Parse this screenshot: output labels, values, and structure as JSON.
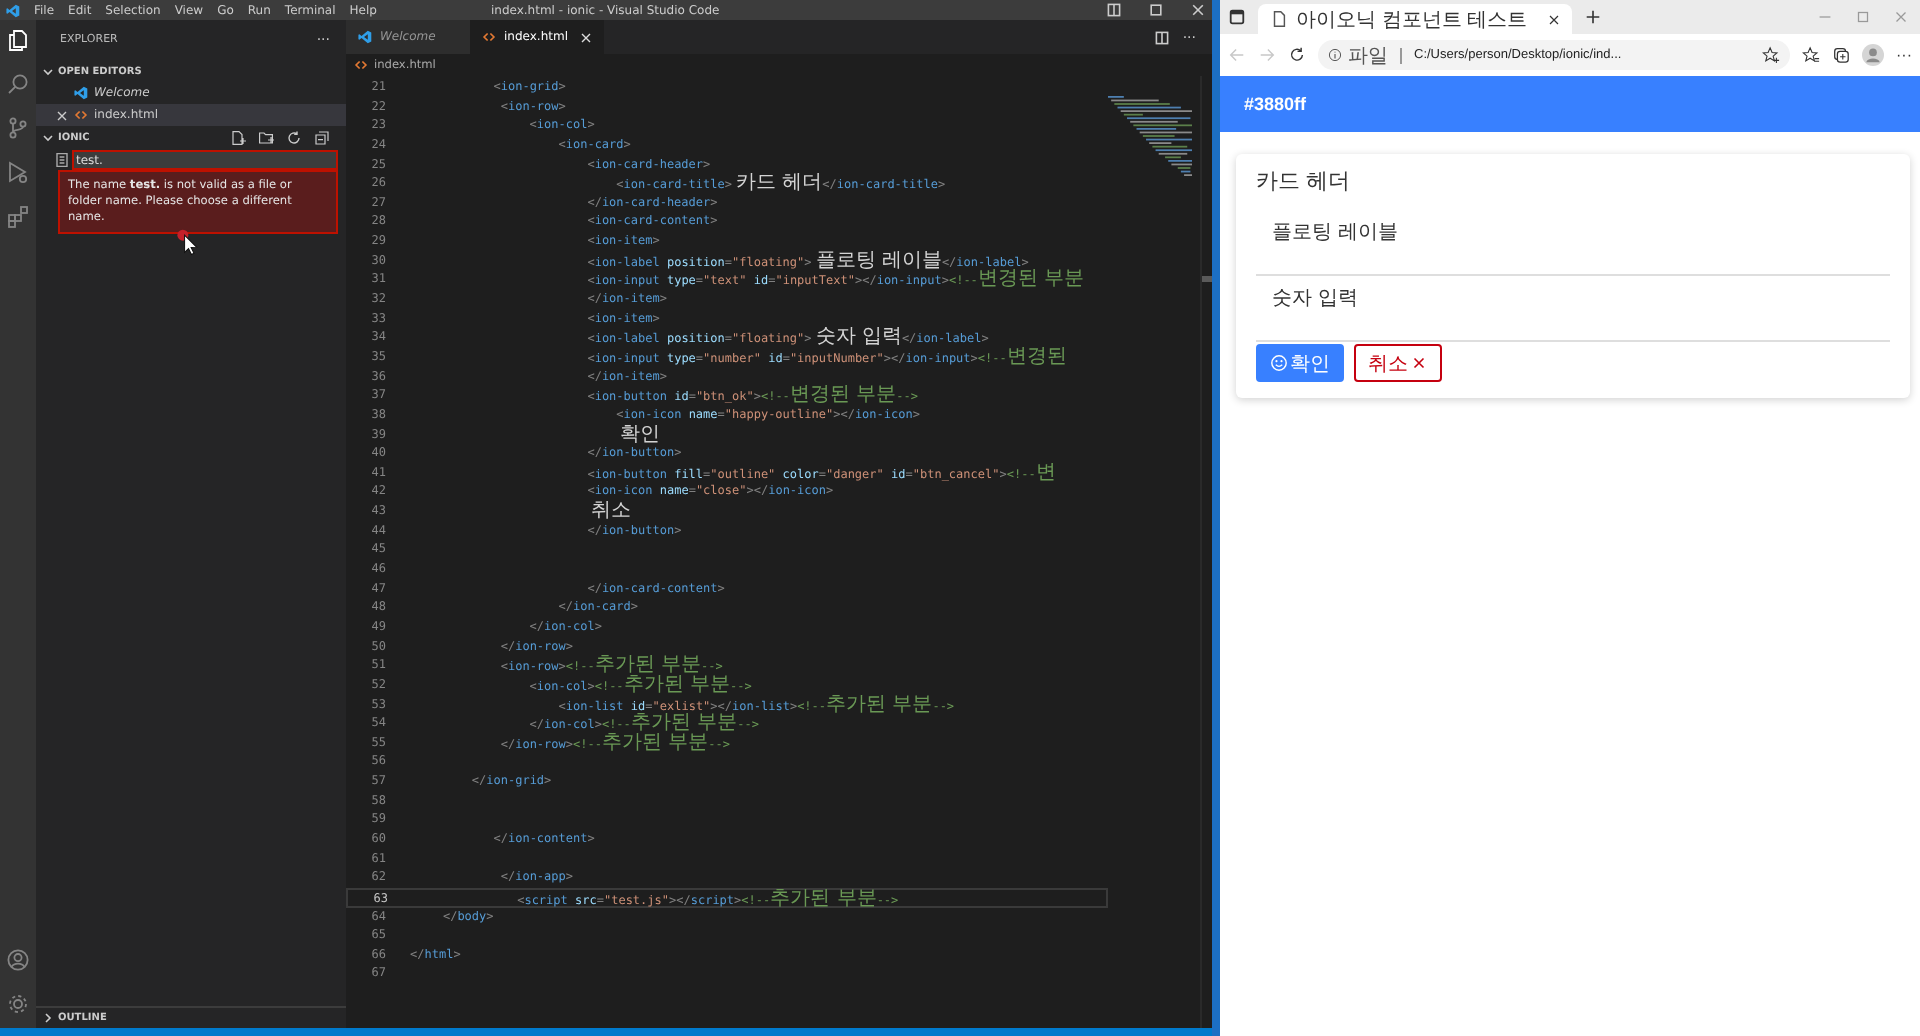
{
  "vscode": {
    "menu": [
      "File",
      "Edit",
      "Selection",
      "View",
      "Go",
      "Run",
      "Terminal",
      "Help"
    ],
    "title": "index.html - ionic - Visual Studio Code",
    "activity_bar": {
      "top": [
        {
          "kind": "files",
          "selected": true
        },
        {
          "kind": "search",
          "selected": false
        },
        {
          "kind": "source-control",
          "selected": false
        },
        {
          "kind": "run",
          "selected": false
        },
        {
          "kind": "extensions",
          "selected": false
        }
      ],
      "bottom": [
        {
          "kind": "account",
          "selected": false
        },
        {
          "kind": "settings",
          "selected": false
        }
      ]
    },
    "sidebar": {
      "title": "EXPLORER",
      "more": "···",
      "open_editors": {
        "title": "OPEN EDITORS",
        "expanded": true,
        "items": [
          {
            "kind": "vscode",
            "label": "Welcome",
            "preview": true,
            "selected": false
          },
          {
            "kind": "html",
            "label": "index.html",
            "preview": false,
            "selected": true
          }
        ]
      },
      "folder": {
        "title": "IONIC",
        "expanded": true,
        "rename_value": "test.",
        "error": "The name **test.** is not valid as a file or folder name. Please choose a different name."
      },
      "outline": {
        "title": "OUTLINE",
        "expanded": false
      }
    },
    "tabs": [
      {
        "kind": "vscode",
        "label": "Welcome",
        "preview": true,
        "selected": false
      },
      {
        "kind": "html",
        "label": "index.html",
        "preview": false,
        "selected": true
      }
    ],
    "editor_more": "···",
    "breadcrumb": "index.html",
    "lines": [
      {
        "number": "21",
        "text": "           <ion-grid>",
        "current": false
      },
      {
        "number": "22",
        "text": "            <ion-row>",
        "current": false
      },
      {
        "number": "23",
        "text": "                <ion-col>",
        "current": false
      },
      {
        "number": "24",
        "text": "                    <ion-card>",
        "current": false
      },
      {
        "number": "25",
        "text": "                        <ion-card-header>",
        "current": false
      },
      {
        "number": "26",
        "text": "                            <ion-card-title>카드 헤더</ion-card-title>",
        "current": false
      },
      {
        "number": "27",
        "text": "                        </ion-card-header>",
        "current": false
      },
      {
        "number": "28",
        "text": "                        <ion-card-content>",
        "current": false
      },
      {
        "number": "29",
        "text": "                        <ion-item>",
        "current": false
      },
      {
        "number": "30",
        "text": "                        <ion-label position=\"floating\">플로팅 레이블</ion-label>",
        "current": false
      },
      {
        "number": "31",
        "text": "                        <ion-input type=\"text\" id=\"inputText\"></ion-input><!--변경된 부분",
        "current": false
      },
      {
        "number": "32",
        "text": "                        </ion-item>",
        "current": false
      },
      {
        "number": "33",
        "text": "                        <ion-item>",
        "current": false
      },
      {
        "number": "34",
        "text": "                        <ion-label position=\"floating\">숫자 입력</ion-label>",
        "current": false
      },
      {
        "number": "35",
        "text": "                        <ion-input type=\"number\" id=\"inputNumber\"></ion-input><!--변경된",
        "current": false
      },
      {
        "number": "36",
        "text": "                        </ion-item>",
        "current": false
      },
      {
        "number": "37",
        "text": "                        <ion-button id=\"btn_ok\"><!--변경된 부분-->",
        "current": false
      },
      {
        "number": "38",
        "text": "                            <ion-icon name=\"happy-outline\"></ion-icon>",
        "current": false
      },
      {
        "number": "39",
        "text": "                            확인",
        "current": false
      },
      {
        "number": "40",
        "text": "                        </ion-button>",
        "current": false
      },
      {
        "number": "41",
        "text": "                        <ion-button fill=\"outline\" color=\"danger\" id=\"btn_cancel\"><!--변",
        "current": false
      },
      {
        "number": "42",
        "text": "                        <ion-icon name=\"close\"></ion-icon>",
        "current": false
      },
      {
        "number": "43",
        "text": "                        취소",
        "current": false
      },
      {
        "number": "44",
        "text": "                        </ion-button>",
        "current": false
      },
      {
        "number": "45",
        "current": false
      },
      {
        "number": "46",
        "current": false
      },
      {
        "number": "47",
        "text": "                        </ion-card-content>",
        "current": false
      },
      {
        "number": "48",
        "text": "                    </ion-card>",
        "current": false
      },
      {
        "number": "49",
        "text": "                </ion-col>",
        "current": false
      },
      {
        "number": "50",
        "text": "            </ion-row>",
        "current": false
      },
      {
        "number": "51",
        "text": "            <ion-row><!--추가된 부분-->",
        "current": false
      },
      {
        "number": "52",
        "text": "                <ion-col><!--추가된 부분-->",
        "current": false
      },
      {
        "number": "53",
        "text": "                    <ion-list id=\"exlist\"></ion-list><!--추가된 부분-->",
        "current": false
      },
      {
        "number": "54",
        "text": "                </ion-col><!--추가된 부분-->",
        "current": false
      },
      {
        "number": "55",
        "text": "            </ion-row><!--추가된 부분-->",
        "current": false
      },
      {
        "number": "56",
        "current": false
      },
      {
        "number": "57",
        "text": "        </ion-grid>",
        "current": false
      },
      {
        "number": "58",
        "current": false
      },
      {
        "number": "59",
        "current": false
      },
      {
        "number": "60",
        "text": "           </ion-content>",
        "current": false
      },
      {
        "number": "61",
        "current": false
      },
      {
        "number": "62",
        "text": "            </ion-app>",
        "current": false
      },
      {
        "number": "63",
        "text": "              <script src=\"test.js\"></script><!--추가된 부분-->",
        "current": true
      },
      {
        "number": "64",
        "text": "    </body>",
        "current": false
      },
      {
        "number": "65",
        "current": false
      },
      {
        "number": "66",
        "text": "</html>",
        "current": false
      },
      {
        "number": "67",
        "current": false
      }
    ]
  },
  "browser": {
    "tab_title": "아이오닉 컴포넌트 테스트",
    "nav": [
      {
        "kind": "back",
        "disabled": true
      },
      {
        "kind": "forward",
        "disabled": true
      }
    ],
    "address": {
      "scheme_label": "파일",
      "url": "C:/Users/person/Desktop/ionic/ind..."
    },
    "more": "···",
    "toolbar_title": "#3880ff",
    "card": {
      "title": "카드 헤더",
      "items": [
        {
          "label": "플로팅 레이블"
        },
        {
          "label": "숫자 입력"
        }
      ],
      "buttons": [
        {
          "kind": "solid",
          "label": "확인"
        },
        {
          "kind": "outline",
          "label": "취소"
        }
      ]
    }
  }
}
